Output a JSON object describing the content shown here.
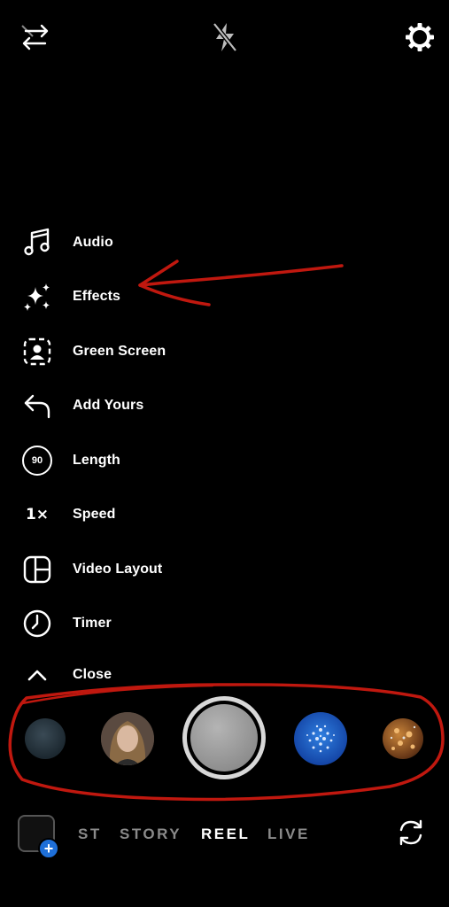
{
  "top_bar": {
    "left_icon": "arrows-swap-icon",
    "center_icon": "flash-off-icon",
    "right_icon": "gear-icon"
  },
  "menu": {
    "items": [
      {
        "label": "Audio",
        "icon": "music-note-icon"
      },
      {
        "label": "Effects",
        "icon": "sparkles-icon"
      },
      {
        "label": "Green Screen",
        "icon": "green-screen-icon"
      },
      {
        "label": "Add Yours",
        "icon": "reply-arrow-icon"
      },
      {
        "label": "Length",
        "icon": "length-icon",
        "badge": "90"
      },
      {
        "label": "Speed",
        "icon": "speed-icon",
        "badge": "1×"
      },
      {
        "label": "Video Layout",
        "icon": "layout-icon"
      },
      {
        "label": "Timer",
        "icon": "clock-icon"
      },
      {
        "label": "Close",
        "icon": "chevron-up-icon"
      }
    ]
  },
  "modes": {
    "post_partial": "ST",
    "story": "STORY",
    "reel": "REEL",
    "live": "LIVE",
    "active": "REEL"
  },
  "gallery": {
    "plus": "+"
  },
  "colors": {
    "background": "#000000",
    "annotation_red": "#c0180f",
    "plus_badge": "#1e6fd8",
    "dim_text": "#8a8a8a"
  }
}
